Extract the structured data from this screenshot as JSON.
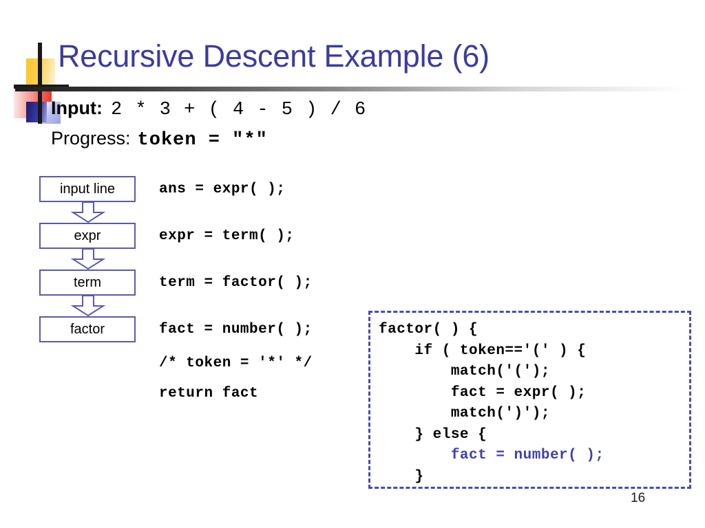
{
  "slide": {
    "title": "Recursive Descent Example (6)",
    "page_number": "16",
    "title_color": "#3b3b9e",
    "accent_color": "#4040aa",
    "box_border_color": "#5a5aa8"
  },
  "header": {
    "input_label": "Input:",
    "input_expression": "2 * 3 + ( 4 - 5 ) / 6",
    "progress_label": "Progress:",
    "progress_value": "token = \"*\""
  },
  "flowchart": {
    "nodes": [
      {
        "label": "input line"
      },
      {
        "label": "expr"
      },
      {
        "label": "term"
      },
      {
        "label": "factor"
      }
    ]
  },
  "trace": {
    "lines": [
      "ans = expr( );",
      "expr = term( );",
      "term = factor( );",
      "fact = number( );",
      "/* token = '*' */",
      "return fact"
    ]
  },
  "factor_code": {
    "lines": [
      {
        "text": "factor( ) {",
        "highlight": false
      },
      {
        "text": "    if ( token=='(' ) {",
        "highlight": false
      },
      {
        "text": "        match('(');",
        "highlight": false
      },
      {
        "text": "        fact = expr( );",
        "highlight": false
      },
      {
        "text": "        match(')');",
        "highlight": false
      },
      {
        "text": "    } else {",
        "highlight": false
      },
      {
        "text": "        fact = number( );",
        "highlight": true
      },
      {
        "text": "    }",
        "highlight": false
      }
    ]
  }
}
